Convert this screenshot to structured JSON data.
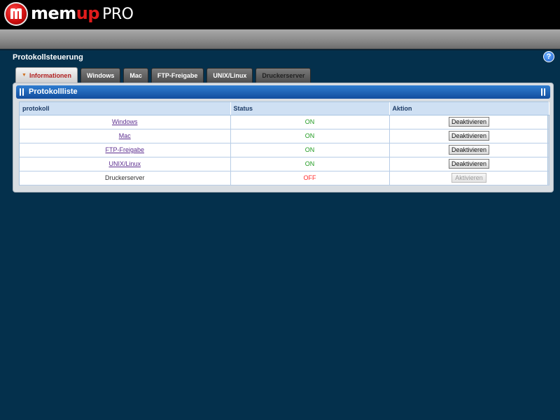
{
  "brand": {
    "part1": "mem",
    "part2": "up",
    "part3": "PRO"
  },
  "page": {
    "title": "Protokollsteuerung",
    "help": "?"
  },
  "tabs": [
    {
      "label": "Informationen",
      "active": true
    },
    {
      "label": "Windows",
      "active": false
    },
    {
      "label": "Mac",
      "active": false
    },
    {
      "label": "FTP-Freigabe",
      "active": false
    },
    {
      "label": "UNIX/Linux",
      "active": false
    },
    {
      "label": "Druckerserver",
      "active": false
    }
  ],
  "panel": {
    "title": "Protokollliste",
    "columns": [
      "protokoll",
      "Status",
      "Aktion"
    ],
    "rows": [
      {
        "name": "Windows",
        "status": "ON",
        "action": "Deaktivieren",
        "link": true,
        "enabled": true
      },
      {
        "name": "Mac",
        "status": "ON",
        "action": "Deaktivieren",
        "link": true,
        "enabled": true
      },
      {
        "name": "FTP-Freigabe",
        "status": "ON",
        "action": "Deaktivieren",
        "link": true,
        "enabled": true
      },
      {
        "name": "UNIX/Linux",
        "status": "ON",
        "action": "Deaktivieren",
        "link": true,
        "enabled": true
      },
      {
        "name": "Druckerserver",
        "status": "OFF",
        "action": "Aktivieren",
        "link": false,
        "enabled": false
      }
    ]
  },
  "colors": {
    "background": "#04304c",
    "status_on": "#1f9a1f",
    "status_off": "#ff2a2a",
    "panel_header": "#1a5fb4"
  }
}
